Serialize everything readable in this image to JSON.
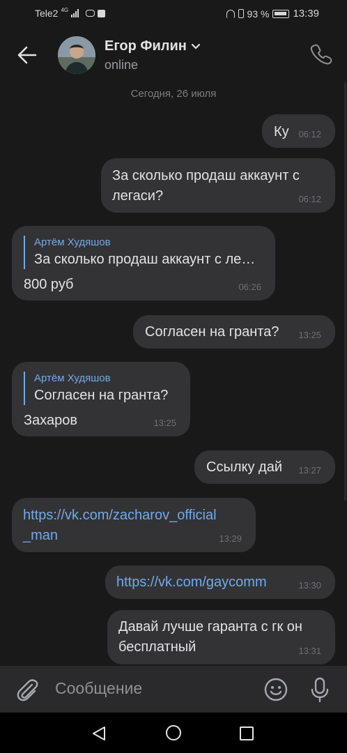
{
  "status_bar": {
    "carrier": "Tele2",
    "network": "4G",
    "battery": "93 %",
    "time": "13:39"
  },
  "header": {
    "contact_name": "Егор Филин",
    "status": "online"
  },
  "chat": {
    "date_separator": "Сегодня, 26 июля",
    "messages": [
      {
        "direction": "out",
        "text": "Ку",
        "time": "06:12"
      },
      {
        "direction": "out",
        "text_lines": [
          "За сколько продаш аккаунт с",
          "легаси?"
        ],
        "time": "06:12"
      },
      {
        "direction": "in",
        "reply_author": "Артём Худяшов",
        "reply_text": "За сколько продаш аккаунт с ле…",
        "text": "800 руб",
        "time": "06:26"
      },
      {
        "direction": "out",
        "text": "Согласен на гранта?",
        "time": "13:25"
      },
      {
        "direction": "in",
        "reply_author": "Артём Худяшов",
        "reply_text": "Согласен на гранта?",
        "text": "Захаров",
        "time": "13:25"
      },
      {
        "direction": "out",
        "text": "Ссылку дай",
        "time": "13:27"
      },
      {
        "direction": "in",
        "link_lines": [
          "https://vk.com/zacharov_official",
          "_man"
        ],
        "time": "13:29"
      },
      {
        "direction": "out",
        "link": "https://vk.com/gaycomm",
        "time": "13:30"
      },
      {
        "direction": "out",
        "text_lines": [
          "Давай лучше гаранта с гк он",
          "бесплатный"
        ],
        "time": "13:31"
      }
    ]
  },
  "composer": {
    "placeholder": "Сообщение"
  },
  "colors": {
    "background": "#191919",
    "bubble": "#333335",
    "link": "#71aaeb",
    "text": "#e1e3e6"
  },
  "icons": [
    "back-arrow-icon",
    "chevron-down-icon",
    "phone-icon",
    "paperclip-icon",
    "emoji-icon",
    "microphone-icon",
    "nav-back-icon",
    "nav-home-icon",
    "nav-recent-icon"
  ]
}
